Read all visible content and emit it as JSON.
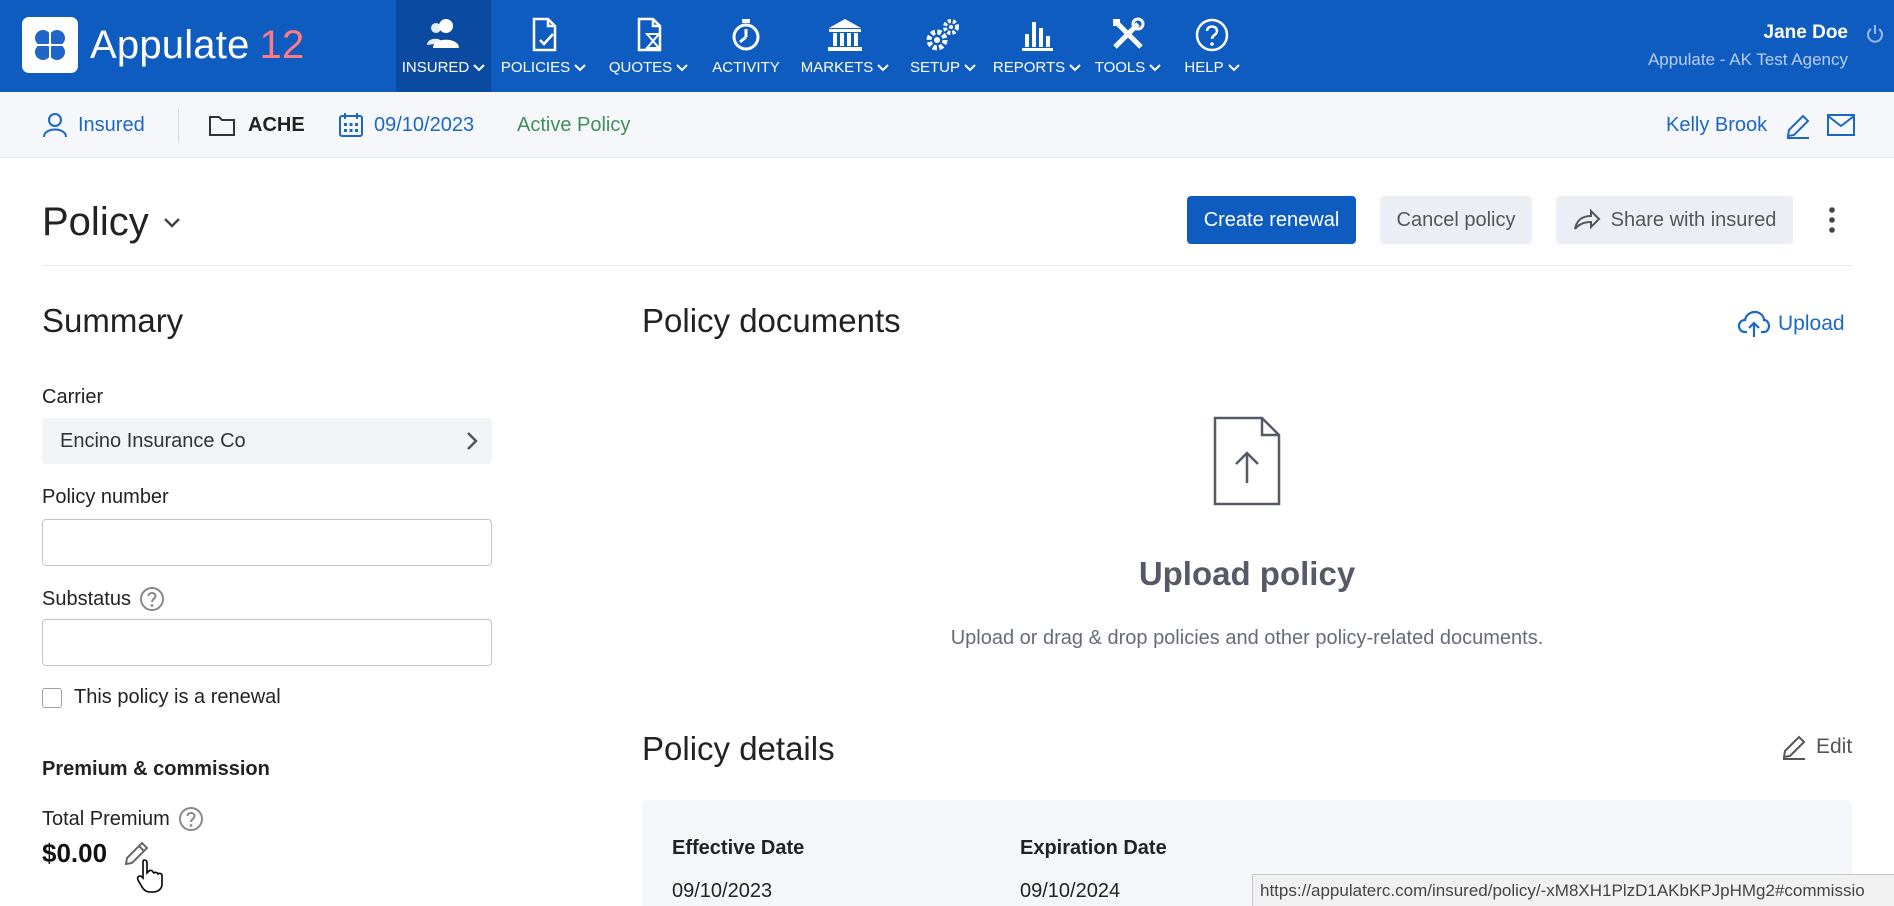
{
  "app": {
    "name": "Appulate",
    "version": "12"
  },
  "nav": {
    "items": [
      {
        "label": "INSURED",
        "icon": "users-icon",
        "dropdown": true,
        "active": true
      },
      {
        "label": "POLICIES",
        "icon": "policy-document-icon",
        "dropdown": true
      },
      {
        "label": "QUOTES",
        "icon": "quote-hourglass-icon",
        "dropdown": true
      },
      {
        "label": "ACTIVITY",
        "icon": "stopwatch-icon",
        "dropdown": false
      },
      {
        "label": "MARKETS",
        "icon": "bank-icon",
        "dropdown": true
      },
      {
        "label": "SETUP",
        "icon": "gears-icon",
        "dropdown": true
      },
      {
        "label": "REPORTS",
        "icon": "bar-chart-icon",
        "dropdown": true
      },
      {
        "label": "TOOLS",
        "icon": "tools-icon",
        "dropdown": true
      },
      {
        "label": "HELP",
        "icon": "help-circle-icon",
        "dropdown": true
      }
    ]
  },
  "user": {
    "name": "Jane Doe",
    "agency": "Appulate - AK Test Agency"
  },
  "subbar": {
    "insured_label": "Insured",
    "folder_label": "ACHE",
    "date": "09/10/2023",
    "status": "Active Policy",
    "agent": "Kelly Brook"
  },
  "page": {
    "title": "Policy",
    "create_renewal": "Create renewal",
    "cancel_policy": "Cancel policy",
    "share_with_insured": "Share with insured"
  },
  "summary": {
    "heading": "Summary",
    "carrier_label": "Carrier",
    "carrier_value": "Encino Insurance Co",
    "policy_number_label": "Policy number",
    "policy_number_value": "",
    "substatus_label": "Substatus",
    "substatus_value": "",
    "renewal_checkbox_label": "This policy is a renewal",
    "renewal_checked": false,
    "premium_heading": "Premium & commission",
    "total_premium_label": "Total Premium",
    "total_premium_value": "$0.00"
  },
  "documents": {
    "heading": "Policy documents",
    "upload_link": "Upload",
    "upload_title": "Upload policy",
    "upload_desc": "Upload or drag & drop policies and other policy-related documents."
  },
  "details": {
    "heading": "Policy details",
    "edit_link": "Edit",
    "effective_label": "Effective Date",
    "effective_value": "09/10/2023",
    "expiration_label": "Expiration Date",
    "expiration_value": "09/10/2024"
  },
  "status_url": "https://appulaterc.com/insured/policy/-xM8XH1PlzD1AKbKPJpHMg2#commissio",
  "colors": {
    "brand_blue": "#0f5cc0",
    "active_nav": "#0a4aa0",
    "version_accent": "#ff7a85",
    "status_green": "#3e8f5a",
    "link_blue": "#1a68c5"
  }
}
